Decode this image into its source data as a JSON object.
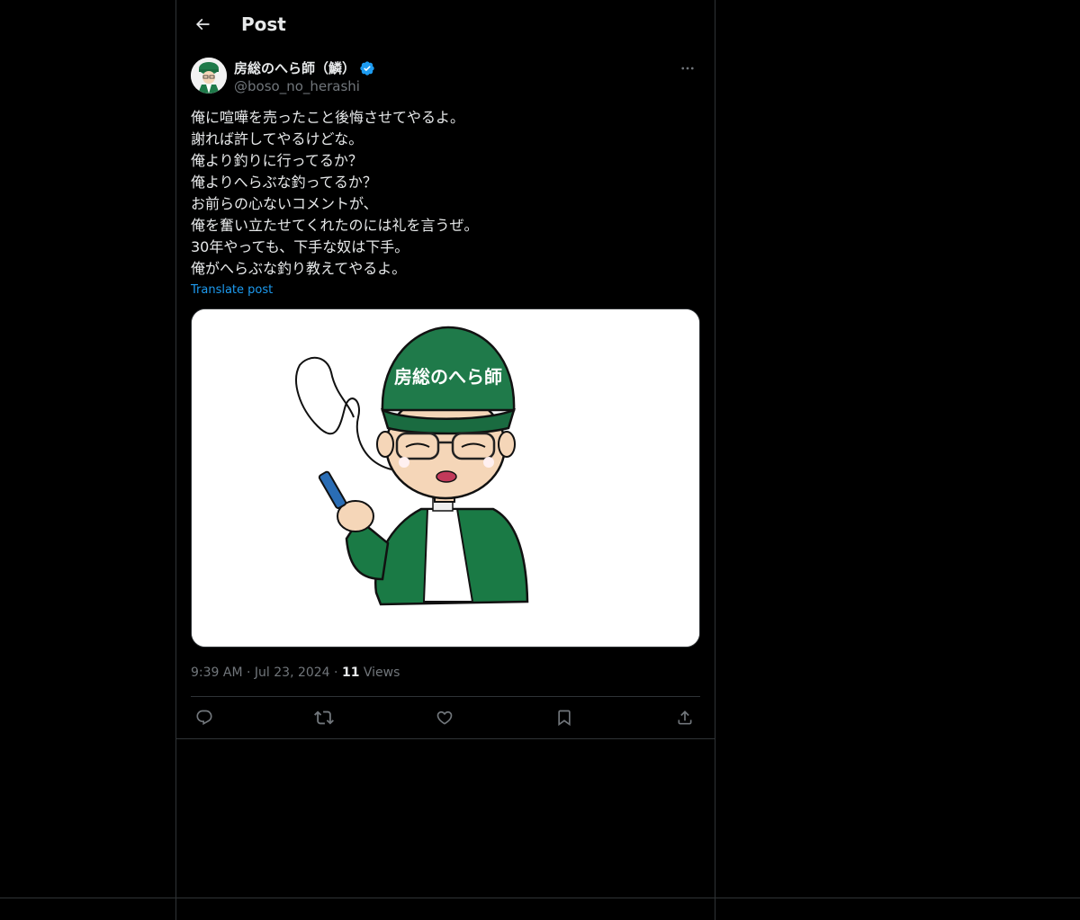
{
  "header": {
    "title": "Post",
    "back_icon": "arrow-left-icon"
  },
  "author": {
    "display_name": "房総のへら師（鱗）",
    "handle": "@boso_no_herashi",
    "verified": true,
    "verified_color": "#1d9bf0"
  },
  "post": {
    "lines": [
      "俺に喧嘩を売ったこと後悔させてやるよ。",
      "謝れば許してやるけどな。",
      "俺より釣りに行ってるか？",
      "俺よりへらぶな釣ってるか？",
      "お前らの心ないコメントが、",
      "俺を奮い立たせてくれたのには礼を言うぜ。",
      "30年やっても、下手な奴は下手。",
      "俺がへらぶな釣り教えてやるよ。"
    ],
    "translate_label": "Translate post",
    "image_cap_text": "房総のへら師",
    "time": "9:39 AM",
    "date": "Jul 23, 2024",
    "separator": "·",
    "views_count": "11",
    "views_label": "Views"
  },
  "actions": [
    {
      "icon": "reply-icon"
    },
    {
      "icon": "retweet-icon"
    },
    {
      "icon": "like-icon"
    },
    {
      "icon": "bookmark-icon"
    },
    {
      "icon": "share-icon"
    }
  ],
  "colors": {
    "background": "#000000",
    "border": "#2f3336",
    "text": "#e7e9ea",
    "muted": "#71767b",
    "accent": "#1d9bf0",
    "cap_green": "#1f7a4a"
  }
}
